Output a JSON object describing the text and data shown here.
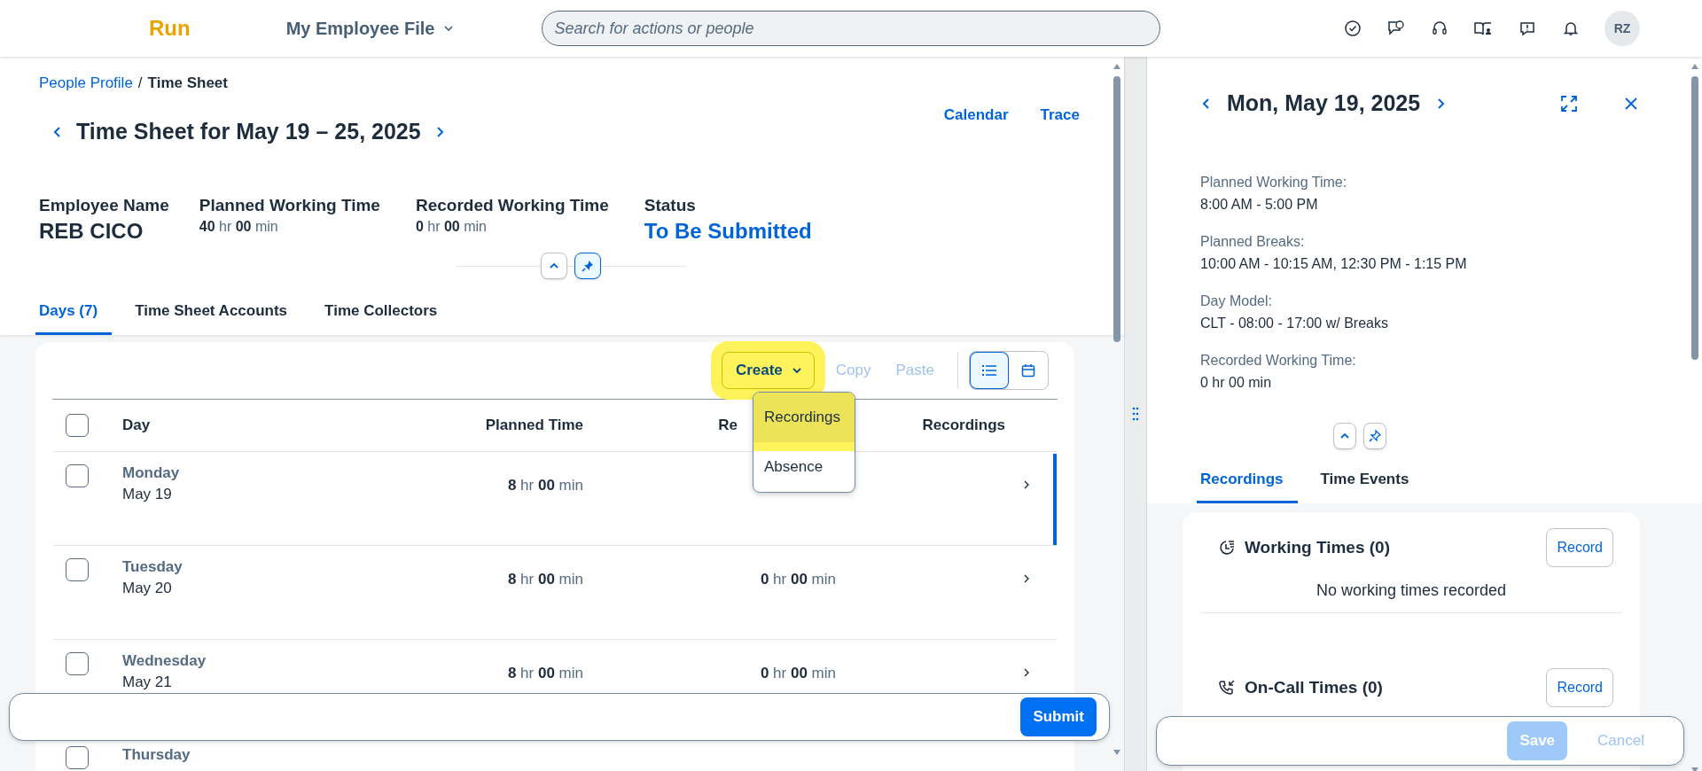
{
  "header": {
    "logo": "Run",
    "app_menu": "My Employee File",
    "search": {
      "placeholder": "Search for actions or people"
    },
    "avatar": "RZ"
  },
  "breadcrumb": {
    "link": "People Profile",
    "separator": "/",
    "current": "Time Sheet"
  },
  "title": "Time Sheet for May 19 – 25, 2025",
  "header_links": [
    "Calendar",
    "Trace"
  ],
  "attributes": [
    {
      "kind": "name",
      "label": "Employee Name",
      "value": "REB CICO"
    },
    {
      "kind": "duration",
      "label": "Planned Working Time",
      "value": "**40** hr  **00** min"
    },
    {
      "kind": "duration",
      "label": "Recorded Working Time",
      "value": "**0** hr  **00** min"
    },
    {
      "kind": "status",
      "label": "Status",
      "value": "To Be Submitted"
    }
  ],
  "tabs": [
    {
      "label": "Days (7)",
      "selected": true
    },
    {
      "label": "Time Sheet Accounts",
      "selected": false
    },
    {
      "label": "Time Collectors",
      "selected": false
    }
  ],
  "toolbar": {
    "create": {
      "label": "Create",
      "highlighted": true
    },
    "actions": [
      {
        "label": "Copy",
        "disabled": true
      },
      {
        "label": "Paste",
        "disabled": true
      }
    ],
    "views": [
      {
        "kind": "list",
        "selected": true
      },
      {
        "kind": "calendar",
        "selected": false
      }
    ]
  },
  "menu": [
    {
      "label": "Recordings",
      "highlighted": true
    },
    {
      "label": "Absence",
      "highlighted": false
    }
  ],
  "table": {
    "select_all_checked": false,
    "columns": [
      "Day",
      "Planned Time",
      "Re",
      "Recordings"
    ],
    "rows": [
      {
        "weekday": "Monday",
        "date": "May 19",
        "planned": "**8** hr  **00** min",
        "checked": false,
        "selected": true
      },
      {
        "weekday": "Tuesday",
        "date": "May 20",
        "planned": "**8** hr  **00** min",
        "recorded": "**0** hr  **00** min",
        "checked": false,
        "selected": false
      },
      {
        "weekday": "Wednesday",
        "date": "May 21",
        "planned": "**8** hr  **00** min",
        "recorded": "**0** hr  **00** min",
        "checked": false,
        "selected": false
      },
      {
        "weekday": "Thursday",
        "checked": false,
        "selected": false
      }
    ]
  },
  "footer": {
    "submit": "Submit"
  },
  "detail": {
    "title": "Mon, May 19, 2025",
    "fields": [
      {
        "label": "Planned Working Time:",
        "value": "8:00 AM - 5:00 PM"
      },
      {
        "label": "Planned Breaks:",
        "value": "10:00 AM - 10:15 AM, 12:30 PM - 1:15 PM"
      },
      {
        "label": "Day Model:",
        "value": "CLT - 08:00 - 17:00 w/ Breaks"
      },
      {
        "label": "Recorded Working Time:",
        "value": "0 hr 00 min"
      }
    ],
    "tabs": [
      {
        "label": "Recordings",
        "selected": true
      },
      {
        "label": "Time Events",
        "selected": false
      }
    ],
    "sections": [
      {
        "kind": "working",
        "title": "Working Times (0)",
        "button": "Record",
        "empty": "No working times recorded"
      },
      {
        "kind": "oncall",
        "title": "On-Call Times (0)",
        "button": "Record"
      }
    ],
    "footer": [
      {
        "label": "Save",
        "kind": "primary",
        "disabled": true
      },
      {
        "label": "Cancel",
        "kind": "ghost",
        "disabled": true
      }
    ]
  }
}
